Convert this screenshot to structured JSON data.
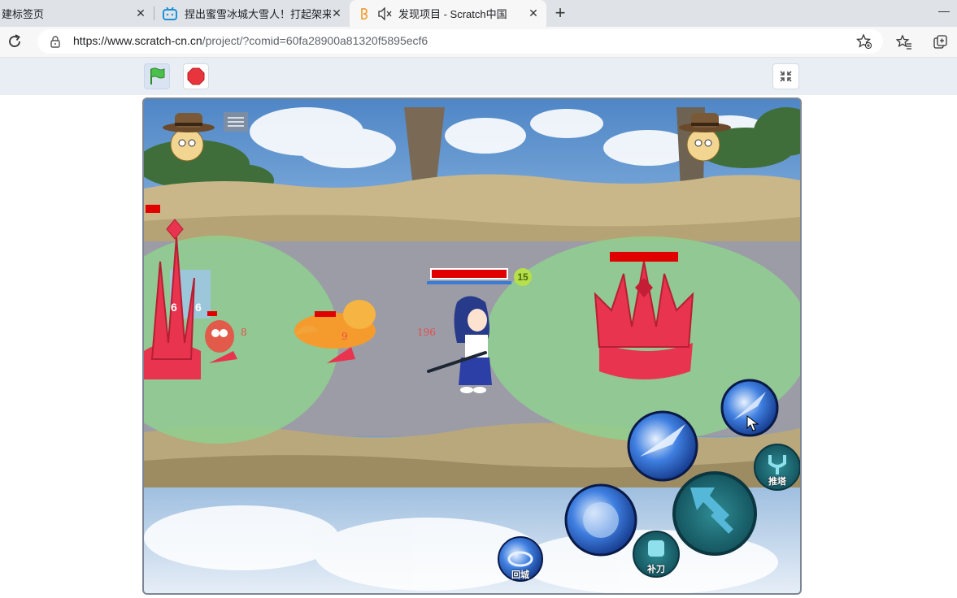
{
  "browser": {
    "tabs": [
      {
        "title": "建标签页",
        "active": false
      },
      {
        "title": "捏出蜜雪冰城大雪人！打起架来",
        "active": false
      },
      {
        "title": "发现项目 - Scratch中国",
        "active": true
      }
    ],
    "new_tab_label": "+",
    "close_glyph": "✕",
    "url_host": "https://www.scratch-cn.cn",
    "url_path": "/project/?comid=60fa28900a81320f5895ecf6"
  },
  "scratch": {
    "flag_icon": "green-flag-icon",
    "stop_icon": "stop-icon",
    "fullscreen_icon": "exit-fullscreen-icon"
  },
  "game": {
    "player_level": "15",
    "tower_left_labels": [
      "6",
      "6"
    ],
    "damage_numbers": [
      {
        "text": "196"
      },
      {
        "text": "8"
      },
      {
        "text": "9"
      }
    ],
    "skills": {
      "push_label": "推塔",
      "last_hit_label": "补刀",
      "recall_label": "回城"
    },
    "colors": {
      "zone": "#8fd08f",
      "tower": "#e8344e",
      "hp": "#e00000",
      "road": "#9c9ca6"
    }
  }
}
